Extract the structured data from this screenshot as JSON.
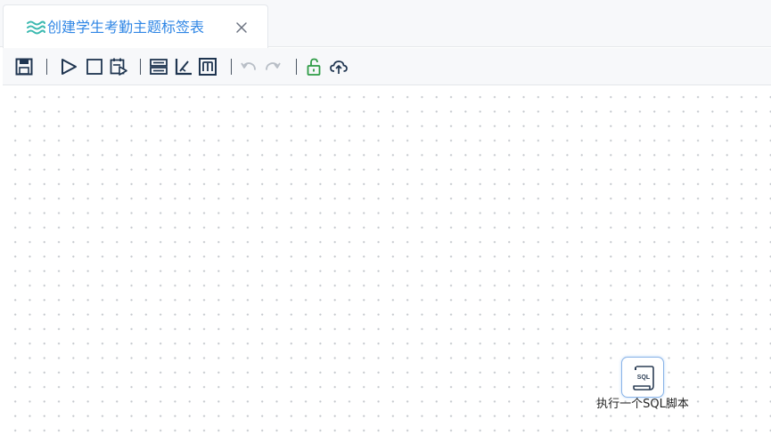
{
  "tab": {
    "title": "创建学生考勤主题标签表",
    "accent_color": "#2f86e5"
  },
  "toolbar": {
    "buttons": [
      {
        "name": "save",
        "icon": "save-icon"
      },
      {
        "name": "run",
        "icon": "play-icon"
      },
      {
        "name": "stop",
        "icon": "stop-icon"
      },
      {
        "name": "run-selected",
        "icon": "run-selected-icon"
      },
      {
        "name": "properties",
        "icon": "properties-icon"
      },
      {
        "name": "format",
        "icon": "format-icon"
      },
      {
        "name": "variables",
        "icon": "variables-icon"
      },
      {
        "name": "undo",
        "icon": "undo-icon"
      },
      {
        "name": "redo",
        "icon": "redo-icon"
      },
      {
        "name": "unlock",
        "icon": "unlock-icon"
      },
      {
        "name": "upload",
        "icon": "cloud-upload-icon"
      }
    ]
  },
  "canvas": {
    "nodes": [
      {
        "icon": "sql-script-icon",
        "icon_text": "SQL",
        "label": "执行一个SQL脚本"
      }
    ]
  }
}
